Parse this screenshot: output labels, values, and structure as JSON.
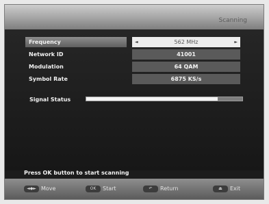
{
  "header": {
    "title": "Scanning"
  },
  "settings": [
    {
      "label": "Frequency",
      "value": "562 MHz",
      "selected": true
    },
    {
      "label": "Network ID",
      "value": "41001"
    },
    {
      "label": "Modulation",
      "value": "64 QAM"
    },
    {
      "label": "Symbol Rate",
      "value": "6875 KS/s"
    }
  ],
  "selector": {
    "left_arrow": "◄",
    "right_arrow": "►"
  },
  "signal": {
    "label": "Signal Status",
    "level_fraction": 0.84
  },
  "instruction": "Press OK button to start scanning",
  "footer": {
    "keys": [
      {
        "cap": "◄◆►",
        "label": "Move",
        "icon": "nav-keys-icon"
      },
      {
        "cap": "OK",
        "label": "Start",
        "icon": "ok-key-icon"
      },
      {
        "cap": "↶",
        "label": "Return",
        "icon": "return-key-icon"
      },
      {
        "cap": "⏏",
        "label": "Exit",
        "icon": "exit-key-icon"
      }
    ]
  },
  "colors": {
    "background": "#1c1c1c",
    "selected_value": "#ececec",
    "value_box": "#5a5a5a",
    "signal_fill": "#f4f4f4"
  }
}
